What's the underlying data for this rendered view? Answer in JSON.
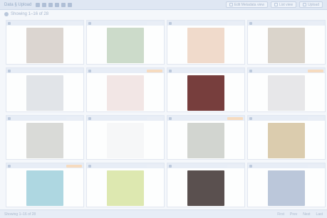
{
  "window": {
    "title": "Data § Upload"
  },
  "toolbar": {
    "buttons": [
      {
        "label": "Edit Metadata view"
      },
      {
        "label": "List view"
      },
      {
        "label": "Upload"
      }
    ]
  },
  "subbar": {
    "text": "Showing 1–16 of 28"
  },
  "cards": [
    {
      "thumb_color": "#d9d2cc",
      "tag": "plain"
    },
    {
      "thumb_color": "#c8d9c5",
      "tag": "plain"
    },
    {
      "thumb_color": "#f0d7c6",
      "tag": "plain"
    },
    {
      "thumb_color": "#d8d1c6",
      "tag": "plain"
    },
    {
      "thumb_color": "#dfe3e6",
      "tag": "plain"
    },
    {
      "thumb_color": "#f2e5e3",
      "tag": "orange"
    },
    {
      "thumb_color": "#6a2b29",
      "tag": "plain"
    },
    {
      "thumb_color": "#e6e6e8",
      "tag": "orange"
    },
    {
      "thumb_color": "#d7d7d4",
      "tag": "plain"
    },
    {
      "thumb_color": "#f7f7f8",
      "tag": "plain"
    },
    {
      "thumb_color": "#cfd2cc",
      "tag": "orange"
    },
    {
      "thumb_color": "#d9c8a6",
      "tag": "plain"
    },
    {
      "thumb_color": "#a7d4df",
      "tag": "orange"
    },
    {
      "thumb_color": "#dbe7a8",
      "tag": "plain"
    },
    {
      "thumb_color": "#4a3e3d",
      "tag": "plain"
    },
    {
      "thumb_color": "#b5c2d7",
      "tag": "plain"
    }
  ],
  "footer": {
    "left": "Showing 1–16 of 28",
    "right": [
      "First",
      "Prev",
      "Next",
      "Last"
    ]
  }
}
